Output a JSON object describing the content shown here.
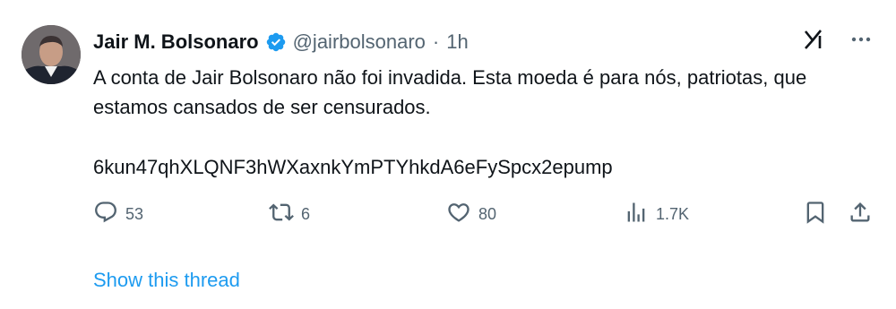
{
  "author": {
    "name": "Jair M. Bolsonaro",
    "handle": "@jairbolsonaro",
    "separator": "·",
    "time": "1h"
  },
  "tweet": {
    "text": "A conta de Jair Bolsonaro não foi invadida. Esta moeda é para nós, patriotas, que estamos cansados de ser censurados.",
    "token_address": "6kun47qhXLQNF3hWXaxnkYmPTYhkdA6eFySpcx2epump"
  },
  "metrics": {
    "replies": "53",
    "retweets": "6",
    "likes": "80",
    "views": "1.7K"
  },
  "thread_link": "Show this thread",
  "colors": {
    "text": "#0f1419",
    "secondary": "#536471",
    "accent": "#1d9bf0"
  },
  "icons": [
    "verified-badge-icon",
    "grok-icon",
    "more-icon",
    "reply-icon",
    "retweet-icon",
    "like-icon",
    "views-icon",
    "bookmark-icon",
    "share-icon"
  ]
}
